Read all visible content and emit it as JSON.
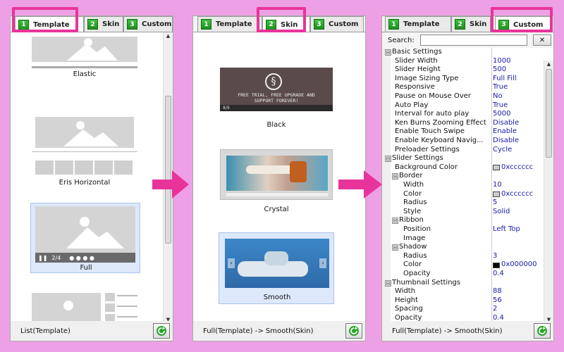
{
  "panels": [
    {
      "tabs": [
        {
          "num": "1",
          "label": "Template"
        },
        {
          "num": "2",
          "label": "Skin"
        },
        {
          "num": "3",
          "label": "Custom"
        }
      ],
      "items": [
        "Elastic",
        "Eris Horizontal",
        "Full"
      ],
      "full_counter": "2/4",
      "status": "List(Template)"
    },
    {
      "tabs": [
        {
          "num": "1",
          "label": "Template"
        },
        {
          "num": "2",
          "label": "Skin"
        },
        {
          "num": "3",
          "label": "Custom"
        }
      ],
      "items": [
        "Black",
        "Crystal",
        "Smooth"
      ],
      "black_banner": "FREE TRIAL, FREE UPGRADE AND SUPPORT FOREVER!",
      "black_counter": "8/9",
      "status": "Full(Template) -> Smooth(Skin)"
    },
    {
      "tabs": [
        {
          "num": "1",
          "label": "Template"
        },
        {
          "num": "2",
          "label": "Skin"
        },
        {
          "num": "3",
          "label": "Custom"
        }
      ],
      "search_label": "Search:",
      "search_value": "",
      "clear_button": "✕",
      "status": "Full(Template) -> Smooth(Skin)"
    }
  ],
  "properties": [
    {
      "type": "cat",
      "label": "Basic Settings",
      "exp": "⊟"
    },
    {
      "label": "Slider Width",
      "value": "1000"
    },
    {
      "label": "Slider Height",
      "value": "500"
    },
    {
      "label": "Image Sizing Type",
      "value": "Full Fill"
    },
    {
      "label": "Responsive",
      "value": "True"
    },
    {
      "label": "Pause on Mouse Over",
      "value": "No"
    },
    {
      "label": "Auto Play",
      "value": "True"
    },
    {
      "label": "Interval for auto play",
      "value": "5000"
    },
    {
      "label": "Ken Burns Zooming Effect",
      "value": "Disable"
    },
    {
      "label": "Enable Touch Swipe",
      "value": "Enable"
    },
    {
      "label": "Enable Keyboard Navig...",
      "value": "Disable"
    },
    {
      "label": "Preloader Settings",
      "value": "Cycle"
    },
    {
      "type": "cat",
      "label": "Slider Settings",
      "exp": "⊟"
    },
    {
      "label": "Background Color",
      "value": "0xcccccc",
      "swatch": "#cccccc"
    },
    {
      "type": "sub",
      "label": "Border",
      "exp": "⊟"
    },
    {
      "indent": 2,
      "label": "Width",
      "value": "10"
    },
    {
      "indent": 2,
      "label": "Color",
      "value": "0xcccccc",
      "swatch": "#cccccc"
    },
    {
      "indent": 2,
      "label": "Radius",
      "value": "5"
    },
    {
      "indent": 2,
      "label": "Style",
      "value": "Solid"
    },
    {
      "type": "sub",
      "label": "Ribbon",
      "exp": "⊟"
    },
    {
      "indent": 2,
      "label": "Position",
      "value": "Left Top"
    },
    {
      "indent": 2,
      "label": "Image",
      "value": ""
    },
    {
      "type": "sub",
      "label": "Shadow",
      "exp": "⊟"
    },
    {
      "indent": 2,
      "label": "Radius",
      "value": "3"
    },
    {
      "indent": 2,
      "label": "Color",
      "value": "0x000000",
      "swatch": "#000000"
    },
    {
      "indent": 2,
      "label": "Opacity",
      "value": "0.4"
    },
    {
      "type": "cat",
      "label": "Thumbnail Settings",
      "exp": "⊟"
    },
    {
      "label": "Width",
      "value": "88"
    },
    {
      "label": "Height",
      "value": "56"
    },
    {
      "label": "Spacing",
      "value": "2"
    },
    {
      "label": "Opacity",
      "value": "0.4"
    }
  ],
  "colors": {
    "background": "#eea0e6",
    "highlight": "#e8349a",
    "arrow": "#e8349a",
    "tab_number": "#2aa52a",
    "value_text": "#1a1aaa",
    "selection": "#dde8fb"
  },
  "icons": [
    "refresh-icon",
    "image-placeholder-icon",
    "arrow-right-icon",
    "clear-icon",
    "pause-icon"
  ]
}
